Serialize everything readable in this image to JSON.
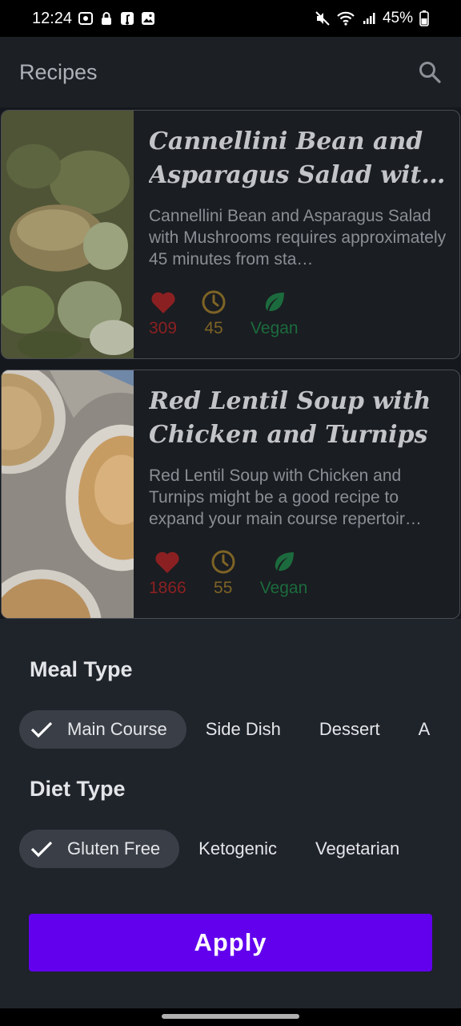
{
  "status_bar": {
    "time": "12:24",
    "battery": "45%",
    "left_icons": [
      "screen-record-icon",
      "lock-icon",
      "music-note-icon",
      "image-icon"
    ],
    "right_icons": [
      "mute-icon",
      "wifi-icon",
      "signal-icon",
      "battery-icon"
    ]
  },
  "app_bar": {
    "title": "Recipes",
    "search_icon": "search-icon"
  },
  "recipes": [
    {
      "title": "Cannellini Bean and Asparagus Salad with …",
      "description": "Cannellini Bean and Asparagus Salad with Mushrooms requires approximately 45 minutes from sta…",
      "likes": "309",
      "minutes": "45",
      "diet": "Vegan"
    },
    {
      "title": "Red Lentil Soup with Chicken and Turnips",
      "description": "Red Lentil Soup with Chicken and Turnips might be a good recipe to expand your main course repertoir…",
      "likes": "1866",
      "minutes": "55",
      "diet": "Vegan"
    }
  ],
  "colors": {
    "heart": "#8b2022",
    "clock": "#7d6326",
    "leaf": "#1c6b3e",
    "accent": "#6200ee"
  },
  "filter_sheet": {
    "meal_heading": "Meal Type",
    "meal_chips": [
      {
        "label": "Main Course",
        "selected": true
      },
      {
        "label": "Side Dish",
        "selected": false
      },
      {
        "label": "Dessert",
        "selected": false
      },
      {
        "label": "A",
        "selected": false
      }
    ],
    "diet_heading": "Diet Type",
    "diet_chips": [
      {
        "label": "Gluten Free",
        "selected": true
      },
      {
        "label": "Ketogenic",
        "selected": false
      },
      {
        "label": "Vegetarian",
        "selected": false
      }
    ],
    "apply_label": "Apply"
  }
}
